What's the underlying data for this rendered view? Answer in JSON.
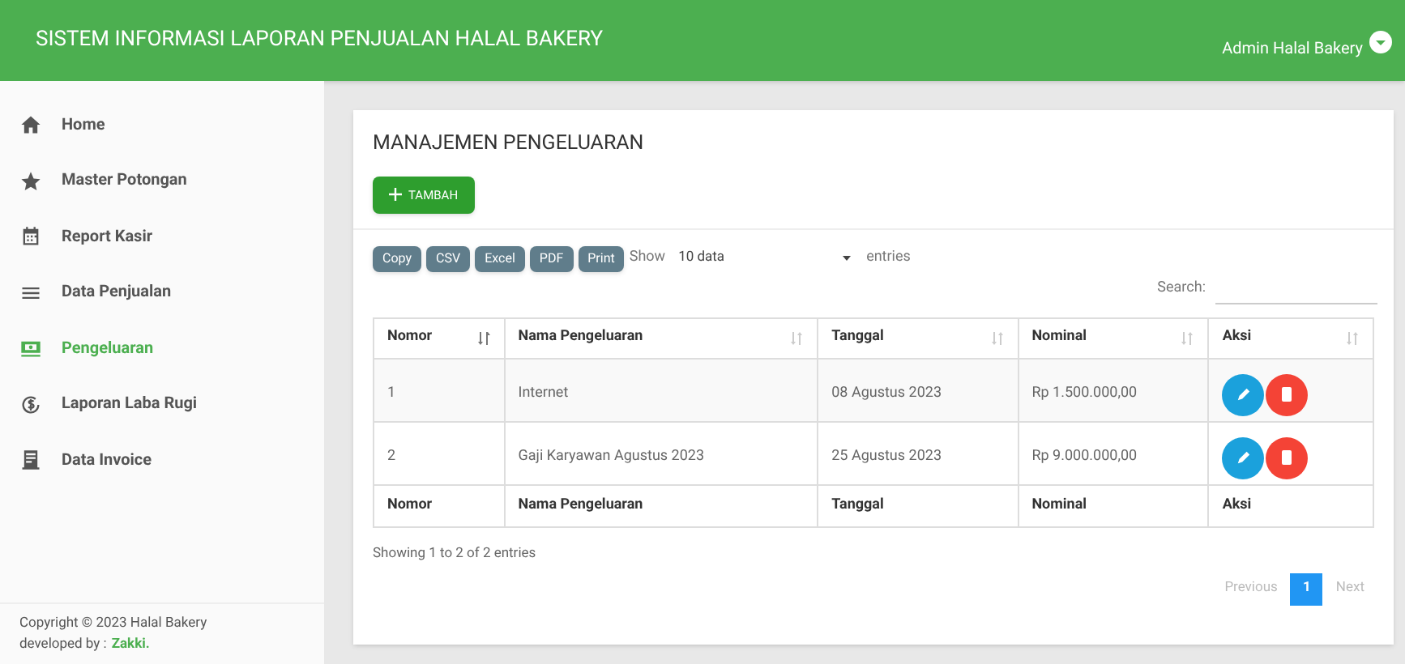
{
  "header": {
    "title": "SISTEM INFORMASI LAPORAN PENJUALAN HALAL BAKERY",
    "user": "Admin Halal Bakery"
  },
  "sidebar": {
    "items": [
      {
        "label": "Home",
        "kind": "home",
        "selected": false
      },
      {
        "label": "Master Potongan",
        "kind": "star",
        "selected": false
      },
      {
        "label": "Report Kasir",
        "kind": "calendar",
        "selected": false
      },
      {
        "label": "Data Penjualan",
        "kind": "menu",
        "selected": false
      },
      {
        "label": "Pengeluaran",
        "kind": "money",
        "selected": true
      },
      {
        "label": "Laporan Laba Rugi",
        "kind": "dollar",
        "selected": false
      },
      {
        "label": "Data Invoice",
        "kind": "receipt",
        "selected": false
      }
    ],
    "footer": {
      "copyright": "Copyright © 2023 Halal Bakery",
      "developed_by": "developed by :",
      "author": "Zakki."
    }
  },
  "card": {
    "title": "MANAJEMEN PENGELUARAN",
    "add_button": "TAMBAH",
    "export_buttons": [
      "Copy",
      "CSV",
      "Excel",
      "PDF",
      "Print"
    ],
    "length": {
      "show": "Show",
      "value": "10 data",
      "entries": "entries"
    },
    "search": {
      "label": "Search:"
    },
    "table": {
      "columns": [
        {
          "label": "Nomor",
          "sorted": true
        },
        {
          "label": "Nama Pengeluaran",
          "sorted": false
        },
        {
          "label": "Tanggal",
          "sorted": false
        },
        {
          "label": "Nominal",
          "sorted": false
        },
        {
          "label": "Aksi",
          "sorted": false
        }
      ],
      "rows": [
        {
          "nomor": "1",
          "nama": "Internet",
          "tanggal": "08 Agustus 2023",
          "nominal": "Rp 1.500.000,00"
        },
        {
          "nomor": "2",
          "nama": "Gaji Karyawan Agustus 2023",
          "tanggal": "25 Agustus 2023",
          "nominal": "Rp 9.000.000,00"
        }
      ],
      "footer": [
        "Nomor",
        "Nama Pengeluaran",
        "Tanggal",
        "Nominal",
        "Aksi"
      ]
    },
    "info": "Showing 1 to 2 of 2 entries",
    "pagination": {
      "previous": {
        "label": "Previous",
        "disabled": true
      },
      "pages": [
        {
          "label": "1",
          "selected": true
        }
      ],
      "next": {
        "label": "Next",
        "disabled": true
      }
    }
  }
}
